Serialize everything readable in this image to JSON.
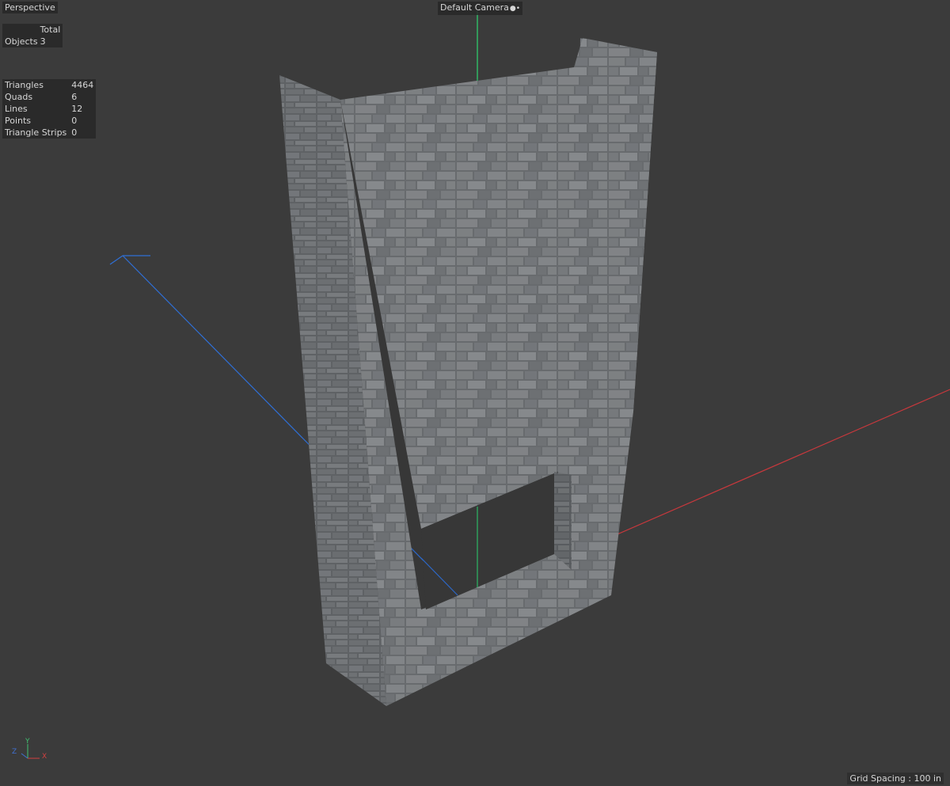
{
  "viewport": {
    "view_name": "Perspective",
    "camera_name": "Default Camera",
    "camera_icon": "camera-icon"
  },
  "objects_stats": {
    "header": "Total",
    "rows": [
      {
        "label": "Objects",
        "value": "3"
      }
    ]
  },
  "polygon_stats": {
    "rows": [
      {
        "label": "Triangles",
        "value": "4464"
      },
      {
        "label": "Quads",
        "value": "6"
      },
      {
        "label": "Lines",
        "value": "12"
      },
      {
        "label": "Points",
        "value": "0"
      },
      {
        "label": "Triangle Strips",
        "value": "0"
      }
    ]
  },
  "grid_spacing": "Grid Spacing : 100 in",
  "axis_gizmo": {
    "labels": {
      "x": "X",
      "y": "Y",
      "z": "Z"
    },
    "colors": {
      "x": "#d04040",
      "y": "#40c070",
      "z": "#4070d0"
    }
  },
  "colors": {
    "background": "#3b3b3b",
    "axis_x": "#c8383c",
    "axis_y": "#2ec36a",
    "axis_z": "#2f6fd6",
    "stone": "#7a7d80"
  }
}
